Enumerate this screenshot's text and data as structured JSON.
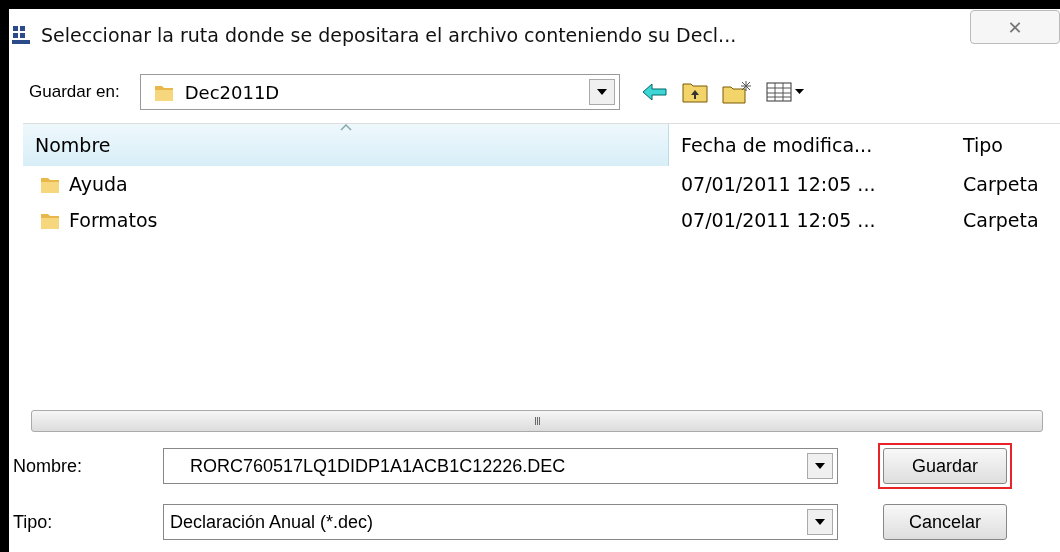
{
  "window": {
    "title": "Seleccionar la ruta donde se depositara el archivo conteniendo su Decl...",
    "close": "✕"
  },
  "location": {
    "label": "Guardar en:",
    "value": "Dec2011D"
  },
  "columns": [
    {
      "label": "Nombre",
      "sorted": true
    },
    {
      "label": "Fecha de modifica...",
      "sorted": false
    },
    {
      "label": "Tipo",
      "sorted": false
    }
  ],
  "files": [
    {
      "name": "Ayuda",
      "date": "07/01/2011 12:05 ...",
      "type": "Carpeta"
    },
    {
      "name": "Formatos",
      "date": "07/01/2011 12:05 ...",
      "type": "Carpeta"
    }
  ],
  "scrollbar": {
    "thumb": "III"
  },
  "fields": [
    {
      "label": "Nombre:",
      "value": "RORC760517LQ1DIDP1A1ACB1C12226.DEC"
    },
    {
      "label": "Tipo:",
      "value": "Declaración Anual (*.dec)"
    }
  ],
  "buttons": [
    {
      "label": "Guardar",
      "highlighted": true
    },
    {
      "label": "Cancelar",
      "highlighted": false
    }
  ]
}
